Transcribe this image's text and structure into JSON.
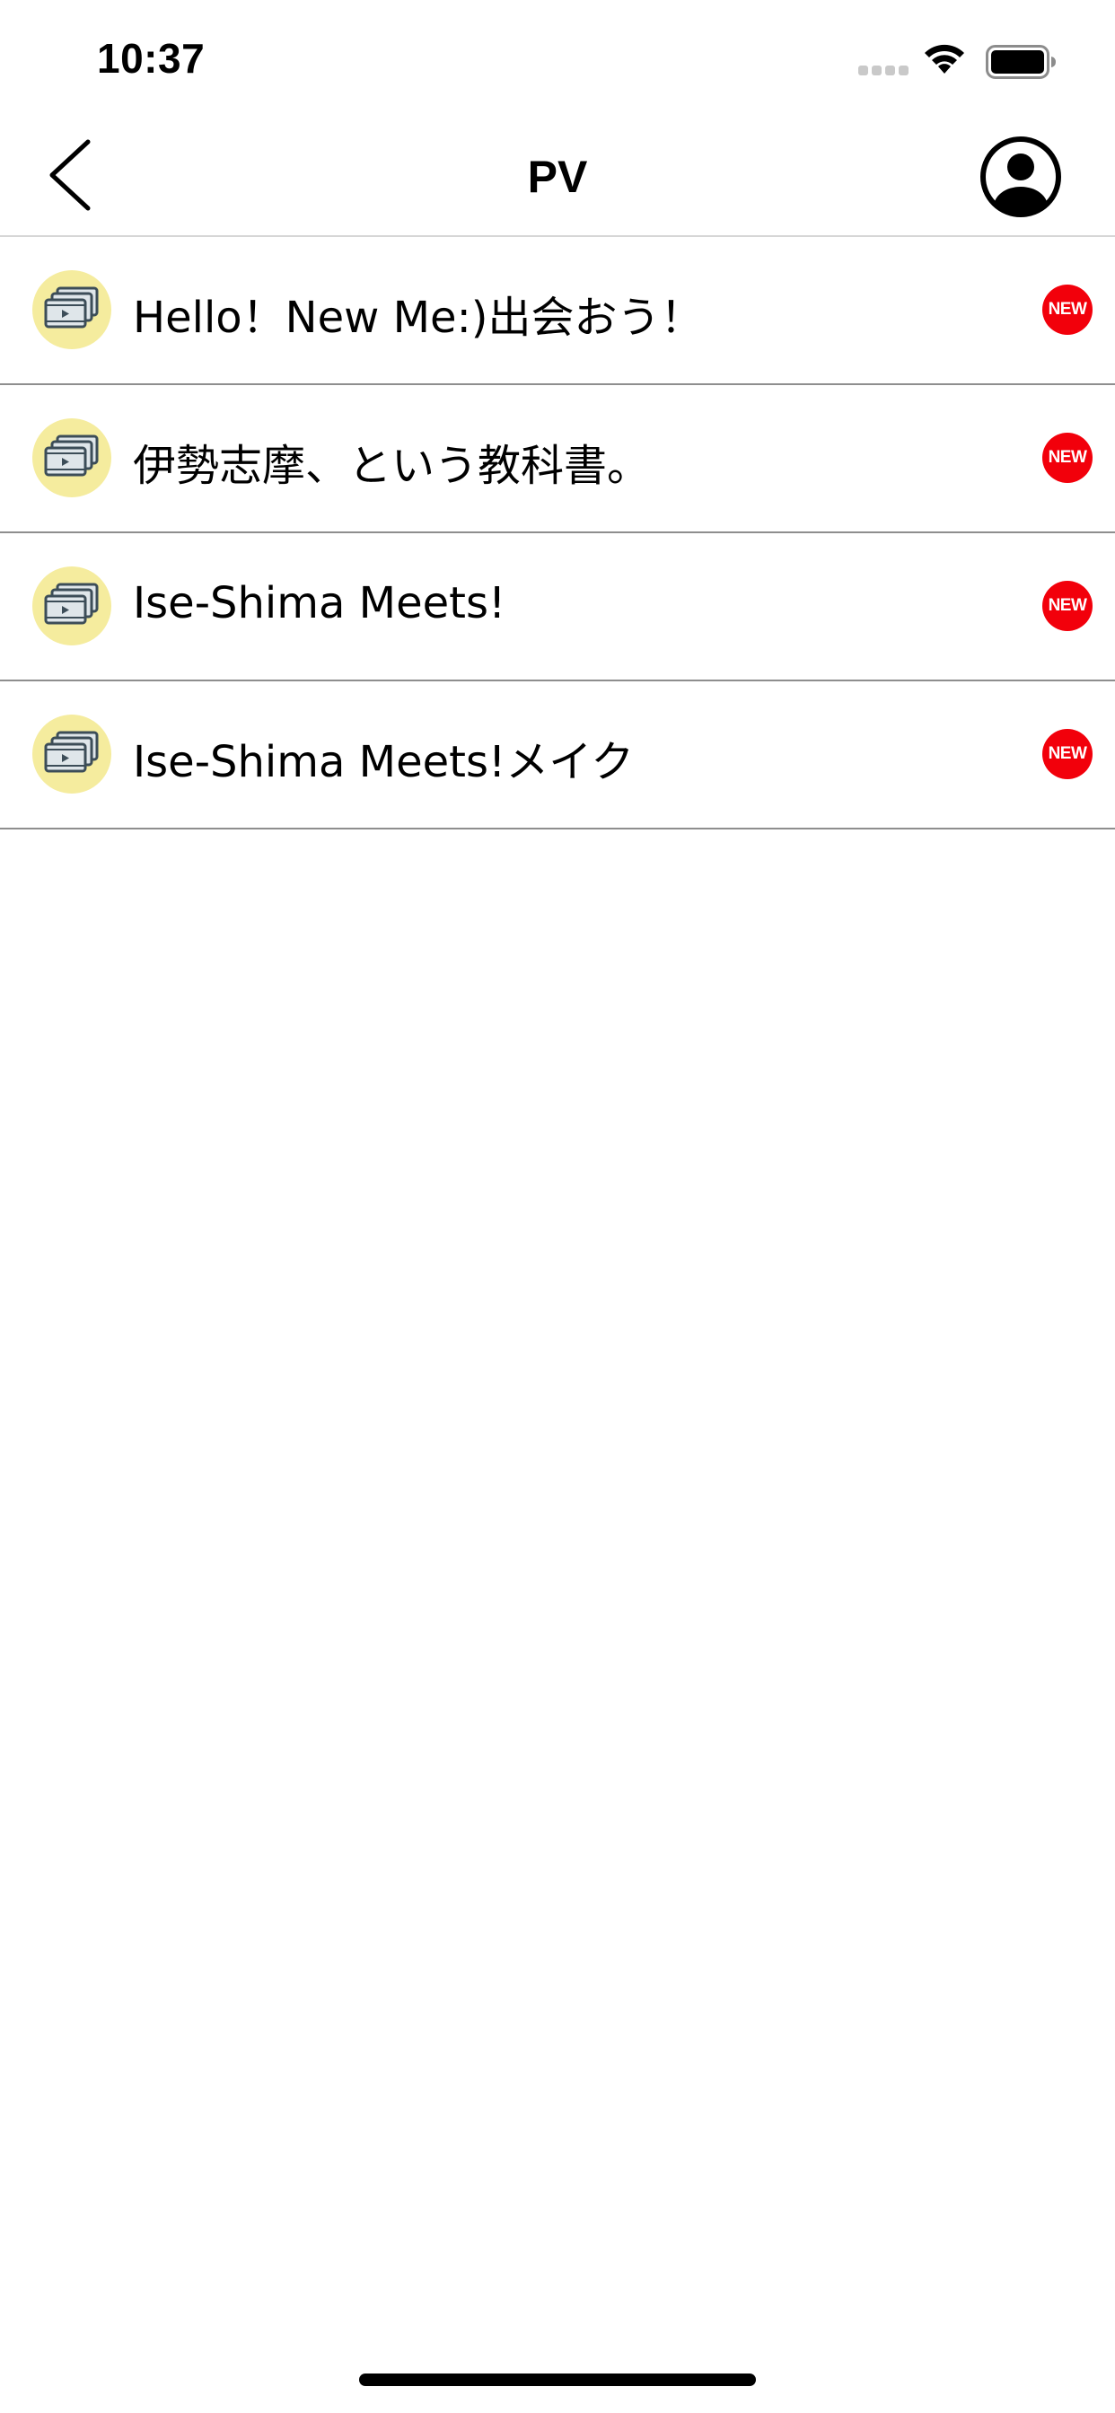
{
  "status_bar": {
    "time": "10:37",
    "icons": [
      "cellular-signal-icon",
      "wifi-icon",
      "battery-icon"
    ]
  },
  "nav": {
    "title": "PV",
    "back_icon": "chevron-left-icon",
    "profile_icon": "user-circle-icon"
  },
  "list": {
    "item_icon": "video-stack-icon",
    "items": [
      {
        "label": "Hello！New Me:)出会おう！",
        "badge": "NEW"
      },
      {
        "label": "伊勢志摩、という教科書。",
        "badge": "NEW"
      },
      {
        "label": "Ise-Shima Meets!",
        "badge": "NEW"
      },
      {
        "label": "Ise-Shima Meets!メイク",
        "badge": "NEW"
      }
    ]
  },
  "colors": {
    "icon_background": "#f5ec9e",
    "badge_red": "#f2000b",
    "divider": "#8e8e8e"
  }
}
